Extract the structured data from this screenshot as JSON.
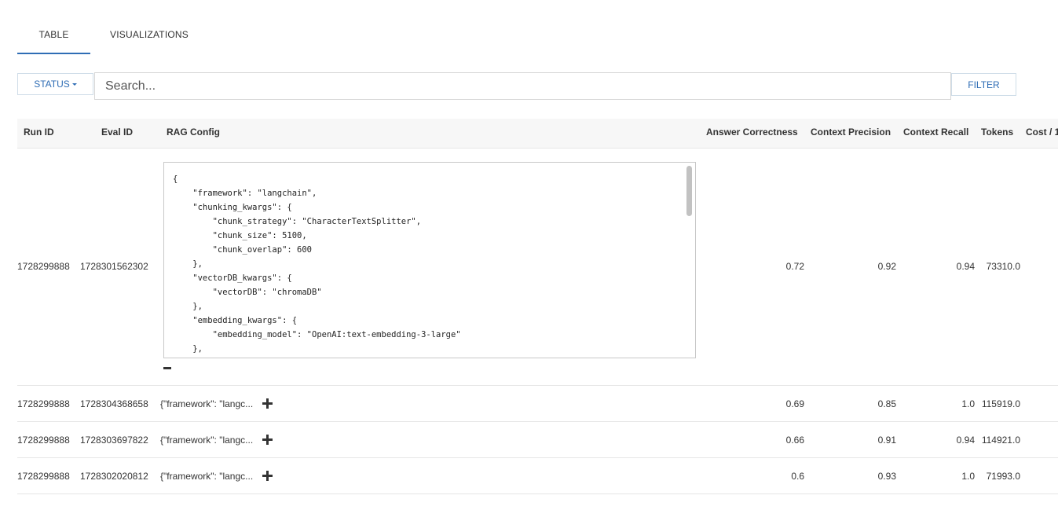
{
  "tabs": [
    {
      "label": "TABLE",
      "active": true
    },
    {
      "label": "VISUALIZATIONS",
      "active": false
    }
  ],
  "toolbar": {
    "status_label": "STATUS",
    "search_placeholder": "Search...",
    "filter_label": "FILTER"
  },
  "table": {
    "columns": [
      "Run ID",
      "Eval ID",
      "RAG Config",
      "Answer Correctness",
      "Context Precision",
      "Context Recall",
      "Tokens",
      "Cost / 1"
    ],
    "expanded_config": "{\n    \"framework\": \"langchain\",\n    \"chunking_kwargs\": {\n        \"chunk_strategy\": \"CharacterTextSplitter\",\n        \"chunk_size\": 5100,\n        \"chunk_overlap\": 600\n    },\n    \"vectorDB_kwargs\": {\n        \"vectorDB\": \"chromaDB\"\n    },\n    \"embedding_kwargs\": {\n        \"embedding_model\": \"OpenAI:text-embedding-3-large\"\n    },\n    \"retriever_kwargs\": {",
    "rows": [
      {
        "run_id": "1728299888",
        "eval_id": "1728301562302",
        "config": "",
        "answer_correctness": "0.72",
        "context_precision": "0.92",
        "context_recall": "0.94",
        "tokens": "73310.0"
      },
      {
        "run_id": "1728299888",
        "eval_id": "1728304368658",
        "config": "{\"framework\": \"langc...",
        "answer_correctness": "0.69",
        "context_precision": "0.85",
        "context_recall": "1.0",
        "tokens": "115919.0"
      },
      {
        "run_id": "1728299888",
        "eval_id": "1728303697822",
        "config": "{\"framework\": \"langc...",
        "answer_correctness": "0.66",
        "context_precision": "0.91",
        "context_recall": "0.94",
        "tokens": "114921.0"
      },
      {
        "run_id": "1728299888",
        "eval_id": "1728302020812",
        "config": "{\"framework\": \"langc...",
        "answer_correctness": "0.6",
        "context_precision": "0.93",
        "context_recall": "1.0",
        "tokens": "71993.0"
      }
    ]
  },
  "colors": {
    "accent": "#2f6db5",
    "header_bg": "#f7f7f7",
    "border": "#e6e6e6"
  }
}
